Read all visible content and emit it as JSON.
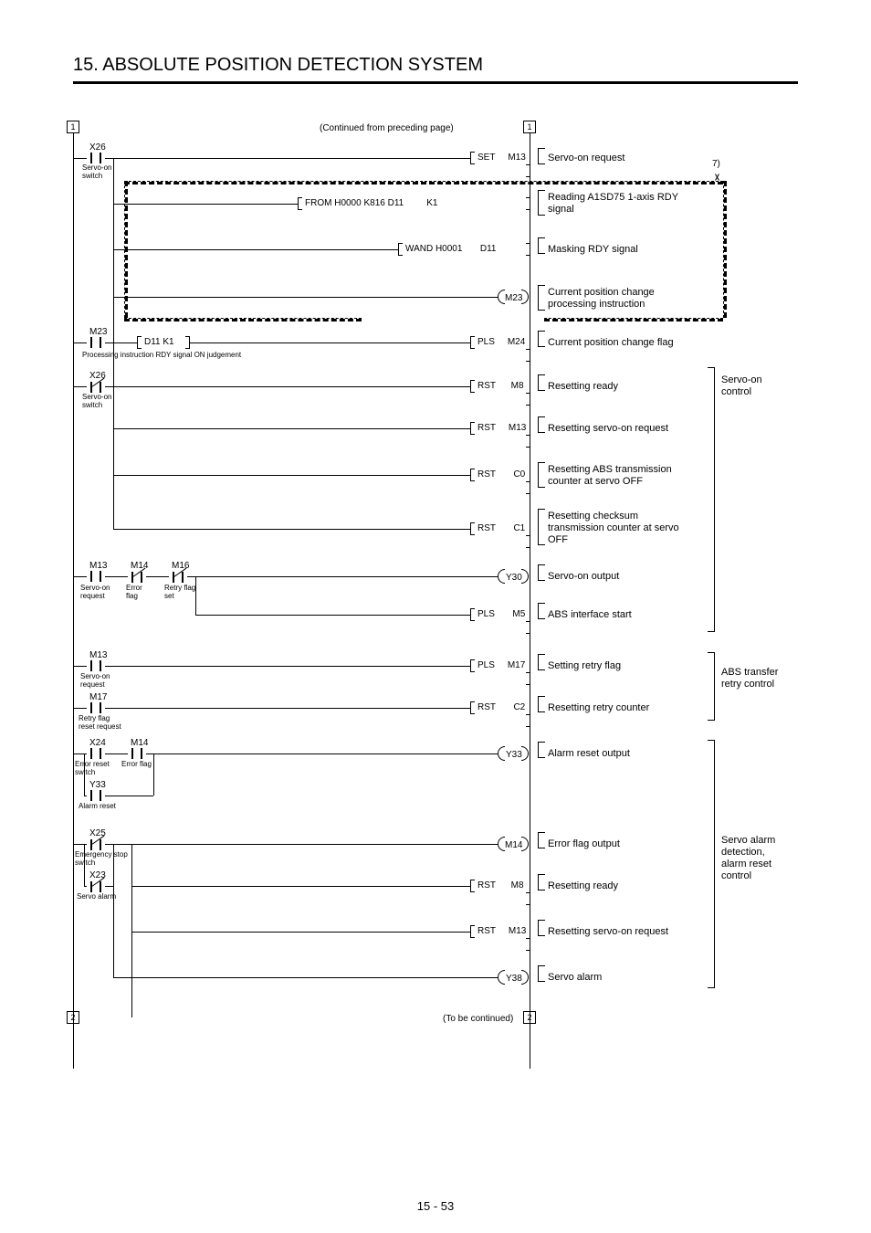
{
  "page_header": "15. ABSOLUTE POSITION DETECTION SYSTEM",
  "page_num": "15 -  53",
  "top_note": "(Continued from preceding page)",
  "bottom_note": "(To be continued)",
  "note7": "7)",
  "contacts": {
    "x26_no": "X26",
    "x26_no_lbl": "Servo-on\nswitch",
    "m23_no": "M23",
    "d11k1": "D11  K1",
    "procline": "Processing instruction  RDY signal ON judgement",
    "x26_nc": "X26",
    "x26_nc_lbl": "Servo-on\nswitch",
    "m13_no": "M13",
    "m13_lbl": "Servo-on\nrequest",
    "m14_nc": "M14",
    "m14_lbl": "Error\nflag",
    "m16_nc": "M16",
    "m16_lbl": "Retry flag\nset",
    "m13b_no": "M13",
    "m13b_lbl": "Servo-on\nrequest",
    "m17_no": "M17",
    "m17_lbl": "Retry flag\nreset request",
    "x24_no": "X24",
    "x24_lbl": "Error reset\nswitch",
    "m14b_no": "M14",
    "m14b_lbl": "Error flag",
    "y33_no": "Y33",
    "y33_lbl": "Alarm reset",
    "x25_nc": "X25",
    "x25_lbl": "Emergency stop\nswitch",
    "x23_nc": "X23",
    "x23_lbl": "Servo alarm"
  },
  "instr": {
    "set_m13": {
      "op": "SET",
      "dev": "M13"
    },
    "from": {
      "txt": "FROM  H0000  K816    D11",
      "dev": "K1"
    },
    "wand": {
      "txt": "WAND  H0001",
      "dev": "D11"
    },
    "m23_coil": "M23",
    "pls_m24": {
      "op": "PLS",
      "dev": "M24"
    },
    "rst_m8": {
      "op": "RST",
      "dev": "M8"
    },
    "rst_m13": {
      "op": "RST",
      "dev": "M13"
    },
    "rst_c0": {
      "op": "RST",
      "dev": "C0"
    },
    "rst_c1": {
      "op": "RST",
      "dev": "C1"
    },
    "y30_coil": "Y30",
    "pls_m5": {
      "op": "PLS",
      "dev": "M5"
    },
    "pls_m17": {
      "op": "PLS",
      "dev": "M17"
    },
    "rst_c2": {
      "op": "RST",
      "dev": "C2"
    },
    "y33_coil": "Y33",
    "m14_coil": "M14",
    "rst_m8b": {
      "op": "RST",
      "dev": "M8"
    },
    "rst_m13b": {
      "op": "RST",
      "dev": "M13"
    },
    "y38_coil": "Y38"
  },
  "desc": {
    "d1": "Servo-on request",
    "d2": "Reading A1SD75 1-axis RDY\nsignal",
    "d3": "Masking RDY signal",
    "d4": "Current position change\nprocessing instruction",
    "d5": "Current position change flag",
    "d6": "Resetting ready",
    "d7": "Resetting servo-on request",
    "d8": "Resetting ABS transmission\ncounter at servo OFF",
    "d9": "Resetting checksum\ntransmission counter at servo\nOFF",
    "d10": "Servo-on output",
    "d11": "ABS interface start",
    "d12": "Setting retry flag",
    "d13": "Resetting retry counter",
    "d14": "Alarm reset output",
    "d15": "Error flag output",
    "d16": "Resetting ready",
    "d17": "Resetting servo-on request",
    "d18": "Servo alarm"
  },
  "groups": {
    "g1": "Servo-on\ncontrol",
    "g2": "ABS transfer\nretry control",
    "g3": "Servo alarm\ndetection,\nalarm reset\ncontrol"
  },
  "conn": {
    "top1": "1",
    "top2": "1",
    "bot1": "2",
    "bot2": "2"
  }
}
